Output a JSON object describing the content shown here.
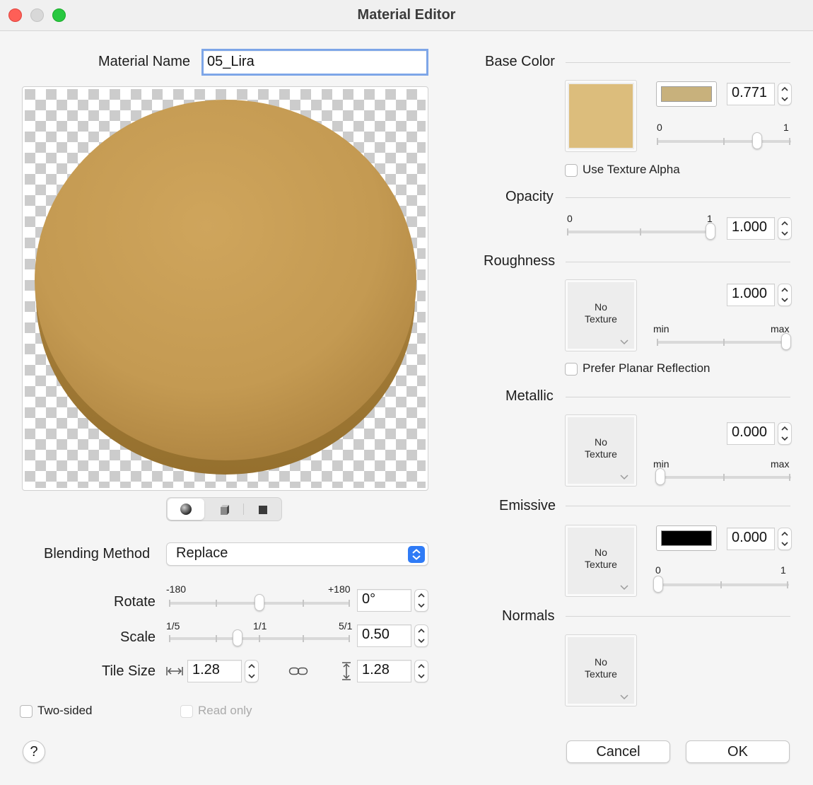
{
  "window": {
    "title": "Material Editor"
  },
  "colors": {
    "base_color_swatch": "#c8b17c",
    "emissive_swatch": "#000000",
    "sphere_color": "#c59c55",
    "focus_ring": "#7ea6e8",
    "accent_blue": "#2f7bf6"
  },
  "left": {
    "material_name_label": "Material Name",
    "material_name_value": "05_Lira",
    "preview_modes": [
      "sphere-icon",
      "cube-icon",
      "plane-icon"
    ],
    "blending_label": "Blending Method",
    "blending_value": "Replace",
    "rotate": {
      "label": "Rotate",
      "min": "-180",
      "max": "+180",
      "value": "0°",
      "slider_fraction": 0.5
    },
    "scale": {
      "label": "Scale",
      "min": "1/5",
      "mid": "1/1",
      "max": "5/1",
      "value": "0.50",
      "slider_fraction": 0.38
    },
    "tile_size": {
      "label": "Tile Size",
      "width": "1.28",
      "height": "1.28"
    },
    "two_sided_label": "Two-sided",
    "read_only_label": "Read only",
    "help_label": "?"
  },
  "right": {
    "base_color": {
      "label": "Base Color",
      "value": "0.771",
      "min": "0",
      "max": "1",
      "slider_fraction": 0.771,
      "use_texture_alpha_label": "Use Texture Alpha"
    },
    "opacity": {
      "label": "Opacity",
      "value": "1.000",
      "min": "0",
      "max": "1",
      "slider_fraction": 1.0
    },
    "roughness": {
      "label": "Roughness",
      "value": "1.000",
      "min": "min",
      "max": "max",
      "slider_fraction": 1.0,
      "texture_line1": "No",
      "texture_line2": "Texture",
      "prefer_planar_label": "Prefer Planar Reflection"
    },
    "metallic": {
      "label": "Metallic",
      "value": "0.000",
      "min": "min",
      "max": "max",
      "slider_fraction": 0.0,
      "texture_line1": "No",
      "texture_line2": "Texture"
    },
    "emissive": {
      "label": "Emissive",
      "value": "0.000",
      "min": "0",
      "max": "1",
      "slider_fraction": 0.0,
      "texture_line1": "No",
      "texture_line2": "Texture"
    },
    "normals": {
      "label": "Normals",
      "texture_line1": "No",
      "texture_line2": "Texture"
    }
  },
  "buttons": {
    "cancel": "Cancel",
    "ok": "OK"
  }
}
